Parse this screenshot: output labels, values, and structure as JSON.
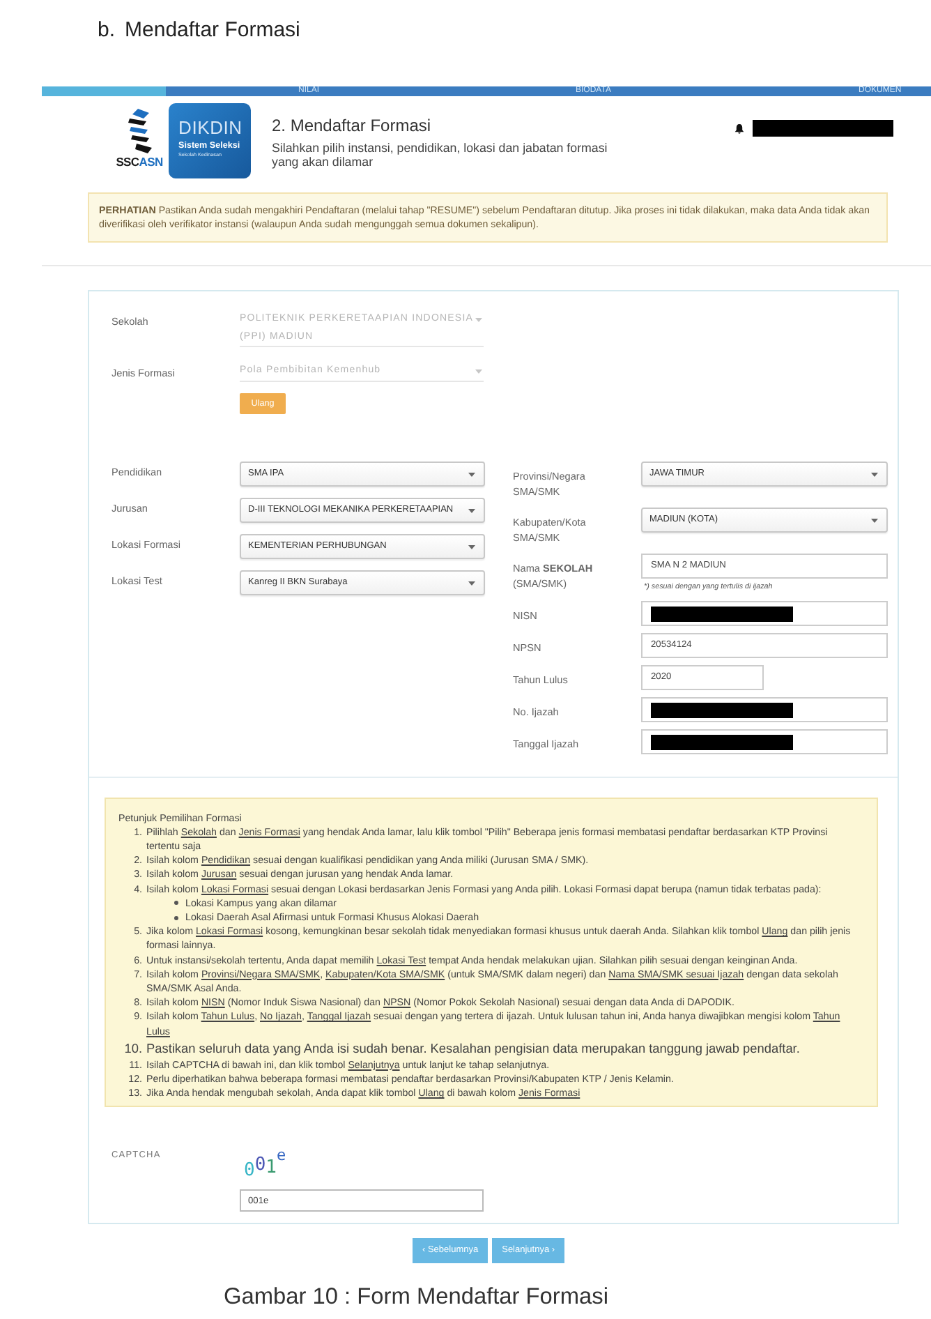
{
  "section": {
    "marker": "b.",
    "title": "Mendaftar Formasi"
  },
  "progress": {
    "level": 0.14,
    "steps": [
      "NILAI",
      "BIODATA",
      "DOKUMEN"
    ]
  },
  "header": {
    "logo_text": {
      "dark": "SSC",
      "accent": "ASN"
    },
    "app_tile": {
      "name": "DIKDIN",
      "tagline": "Sistem Seleksi",
      "subtitle": "Sekolah Kedinasan"
    },
    "title": "2. Mendaftar Formasi",
    "subtitle": "Silahkan pilih instansi, pendidikan, lokasi dan jabatan formasi yang akan dilamar",
    "user": {
      "redacted": true
    }
  },
  "alert": "**PERHATIAN** Pastikan Anda sudah mengakhiri Pendaftaran (melalui tahap \"RESUME\") sebelum Pendaftaran ditutup. Jika proses ini tidak dilakukan, maka data Anda tidak akan diverifikasi oleh verifikator instansi (walaupun Anda sudah mengunggah semua dokumen sekalipun).",
  "school": {
    "fields": [
      {
        "label": "Sekolah",
        "value": "POLITEKNIK PERKERETAAPIAN INDONESIA (PPI) MADIUN",
        "disabled": true
      },
      {
        "label": "Jenis Formasi",
        "value": "Pola Pembibitan Kemenhub",
        "disabled": true
      }
    ],
    "reset_button": "Ulang"
  },
  "form_left": [
    {
      "label": "Pendidikan",
      "value": "SMA IPA",
      "disabled": false
    },
    {
      "label": "Jurusan",
      "value": "D-III TEKNOLOGI MEKANIKA PERKERETAAPIAN",
      "disabled": false
    },
    {
      "label": "Lokasi Formasi",
      "value": "KEMENTERIAN PERHUBUNGAN",
      "disabled": false
    },
    {
      "label": "Lokasi Test",
      "value": "Kanreg II BKN Surabaya",
      "disabled": false
    }
  ],
  "form_right": [
    {
      "label": "Provinsi/Negara SMA/SMK",
      "kind": "select",
      "value": "JAWA TIMUR",
      "disabled": false,
      "redacted": false
    },
    {
      "label": "Kabupaten/Kota SMA/SMK",
      "kind": "select",
      "value": "MADIUN (KOTA)",
      "disabled": false,
      "redacted": false
    },
    {
      "label": "Nama **SEKOLAH** (SMA/SMK)",
      "kind": "text",
      "value": "SMA N 2 MADIUN",
      "hint": "*) sesuai dengan yang tertulis di ijazah",
      "disabled": false,
      "redacted": false
    },
    {
      "label": "NISN",
      "kind": "text",
      "disabled": false,
      "redacted": true
    },
    {
      "label": "NPSN",
      "kind": "text",
      "value": "20534124",
      "disabled": false,
      "redacted": false
    },
    {
      "label": "Tahun Lulus",
      "kind": "short-text",
      "value": "2020",
      "disabled": false,
      "redacted": false
    },
    {
      "label": "No. Ijazah",
      "kind": "text",
      "disabled": false,
      "redacted": true
    },
    {
      "label": "Tanggal Ijazah",
      "kind": "text",
      "disabled": false,
      "redacted": true
    }
  ],
  "instructions": {
    "title": "Petunjuk Pemilihan Formasi",
    "items": [
      {
        "number": "1.",
        "kind": "normal",
        "parts": [
          {
            "text": "Pilihlah ",
            "kind": "plain"
          },
          {
            "text": "Sekolah",
            "kind": "underlined"
          },
          {
            "text": " dan ",
            "kind": "plain"
          },
          {
            "text": "Jenis Formasi",
            "kind": "underlined"
          },
          {
            "text": " yang hendak Anda lamar, lalu klik tombol \"Pilih\" Beberapa jenis formasi membatasi pendaftar berdasarkan KTP Provinsi tertentu saja",
            "kind": "plain"
          }
        ]
      },
      {
        "number": "2.",
        "kind": "normal",
        "parts": [
          {
            "text": "Isilah kolom ",
            "kind": "plain"
          },
          {
            "text": "Pendidikan",
            "kind": "underlined"
          },
          {
            "text": " sesuai dengan kualifikasi pendidikan yang Anda miliki (Jurusan SMA / SMK).",
            "kind": "plain"
          }
        ]
      },
      {
        "number": "3.",
        "kind": "normal",
        "parts": [
          {
            "text": "Isilah kolom ",
            "kind": "plain"
          },
          {
            "text": "Jurusan",
            "kind": "underlined"
          },
          {
            "text": " sesuai dengan jurusan yang hendak Anda lamar.",
            "kind": "plain"
          }
        ]
      },
      {
        "number": "4.",
        "kind": "normal",
        "parts": [
          {
            "text": "Isilah kolom ",
            "kind": "plain"
          },
          {
            "text": "Lokasi Formasi",
            "kind": "underlined"
          },
          {
            "text": " sesuai dengan Lokasi berdasarkan Jenis Formasi yang Anda pilih. Lokasi Formasi dapat berupa (namun tidak terbatas pada):",
            "kind": "plain"
          }
        ],
        "children": [
          {
            "parts": [
              {
                "text": "Lokasi Kampus yang akan dilamar",
                "kind": "plain"
              }
            ]
          },
          {
            "parts": [
              {
                "text": "Lokasi Daerah Asal Afirmasi untuk Formasi Khusus Alokasi Daerah",
                "kind": "plain"
              }
            ]
          }
        ]
      },
      {
        "number": "5.",
        "kind": "normal",
        "parts": [
          {
            "text": "Jika kolom ",
            "kind": "plain"
          },
          {
            "text": "Lokasi Formasi",
            "kind": "underlined"
          },
          {
            "text": " kosong, kemungkinan besar sekolah tidak menyediakan formasi khusus untuk daerah Anda. Silahkan klik tombol ",
            "kind": "plain"
          },
          {
            "text": "Ulang",
            "kind": "underlined"
          },
          {
            "text": " dan pilih jenis formasi lainnya.",
            "kind": "plain"
          }
        ]
      },
      {
        "number": "6.",
        "kind": "normal",
        "parts": [
          {
            "text": "Untuk instansi/sekolah tertentu, Anda dapat memilih ",
            "kind": "plain"
          },
          {
            "text": "Lokasi Test",
            "kind": "underlined"
          },
          {
            "text": " tempat Anda hendak melakukan ujian. Silahkan pilih sesuai dengan keinginan Anda.",
            "kind": "plain"
          }
        ]
      },
      {
        "number": "7.",
        "kind": "normal",
        "parts": [
          {
            "text": "Isilah kolom ",
            "kind": "plain"
          },
          {
            "text": "Provinsi/Negara SMA/SMK",
            "kind": "underlined"
          },
          {
            "text": ", ",
            "kind": "plain"
          },
          {
            "text": "Kabupaten/Kota SMA/SMK",
            "kind": "underlined"
          },
          {
            "text": " (untuk SMA/SMK dalam negeri) dan ",
            "kind": "plain"
          },
          {
            "text": "Nama SMA/SMK sesuai Ijazah",
            "kind": "underlined"
          },
          {
            "text": " dengan data sekolah SMA/SMK Asal Anda.",
            "kind": "plain"
          }
        ]
      },
      {
        "number": "8.",
        "kind": "normal",
        "parts": [
          {
            "text": "Isilah kolom ",
            "kind": "plain"
          },
          {
            "text": "NISN",
            "kind": "underlined"
          },
          {
            "text": " (Nomor Induk Siswa Nasional) dan ",
            "kind": "plain"
          },
          {
            "text": "NPSN",
            "kind": "underlined"
          },
          {
            "text": " (Nomor Pokok Sekolah Nasional) sesuai dengan data Anda di DAPODIK.",
            "kind": "plain"
          }
        ]
      },
      {
        "number": "9.",
        "kind": "normal",
        "parts": [
          {
            "text": "Isilah kolom ",
            "kind": "plain"
          },
          {
            "text": "Tahun Lulus",
            "kind": "underlined"
          },
          {
            "text": ", ",
            "kind": "plain"
          },
          {
            "text": "No Ijazah",
            "kind": "underlined"
          },
          {
            "text": ", ",
            "kind": "plain"
          },
          {
            "text": "Tanggal Ijazah",
            "kind": "underlined"
          },
          {
            "text": " sesuai dengan yang tertera di ijazah. Untuk lulusan tahun ini, Anda hanya diwajibkan mengisi kolom ",
            "kind": "plain"
          },
          {
            "text": "Tahun Lulus",
            "kind": "underlined"
          }
        ]
      },
      {
        "number": "10.",
        "kind": "large",
        "parts": [
          {
            "text": "Pastikan seluruh data yang Anda isi sudah benar. Kesalahan pengisian data merupakan tanggung jawab pendaftar.",
            "kind": "plain"
          }
        ]
      },
      {
        "number": "11.",
        "kind": "normal",
        "parts": [
          {
            "text": "Isilah CAPTCHA di bawah ini, dan klik tombol ",
            "kind": "plain"
          },
          {
            "text": "Selanjutnya",
            "kind": "underlined"
          },
          {
            "text": " untuk lanjut ke tahap selanjutnya.",
            "kind": "plain"
          }
        ]
      },
      {
        "number": "12.",
        "kind": "normal",
        "parts": [
          {
            "text": "Perlu diperhatikan bahwa beberapa formasi membatasi pendaftar berdasarkan Provinsi/Kabupaten KTP / Jenis Kelamin.",
            "kind": "plain"
          }
        ]
      },
      {
        "number": "13.",
        "kind": "normal",
        "parts": [
          {
            "text": "Jika Anda hendak mengubah sekolah, Anda dapat klik tombol ",
            "kind": "plain"
          },
          {
            "text": "Ulang",
            "kind": "underlined"
          },
          {
            "text": " di bawah kolom ",
            "kind": "plain"
          },
          {
            "text": "Jenis Formasi",
            "kind": "underlined"
          }
        ]
      }
    ]
  },
  "captcha": {
    "label": "CAPTCHA",
    "image_text": "001e",
    "value": "001e"
  },
  "buttons": [
    "‹ Sebelumnya",
    "Selanjutnya ›"
  ],
  "caption": "Gambar 10 : Form Mendaftar Formasi"
}
